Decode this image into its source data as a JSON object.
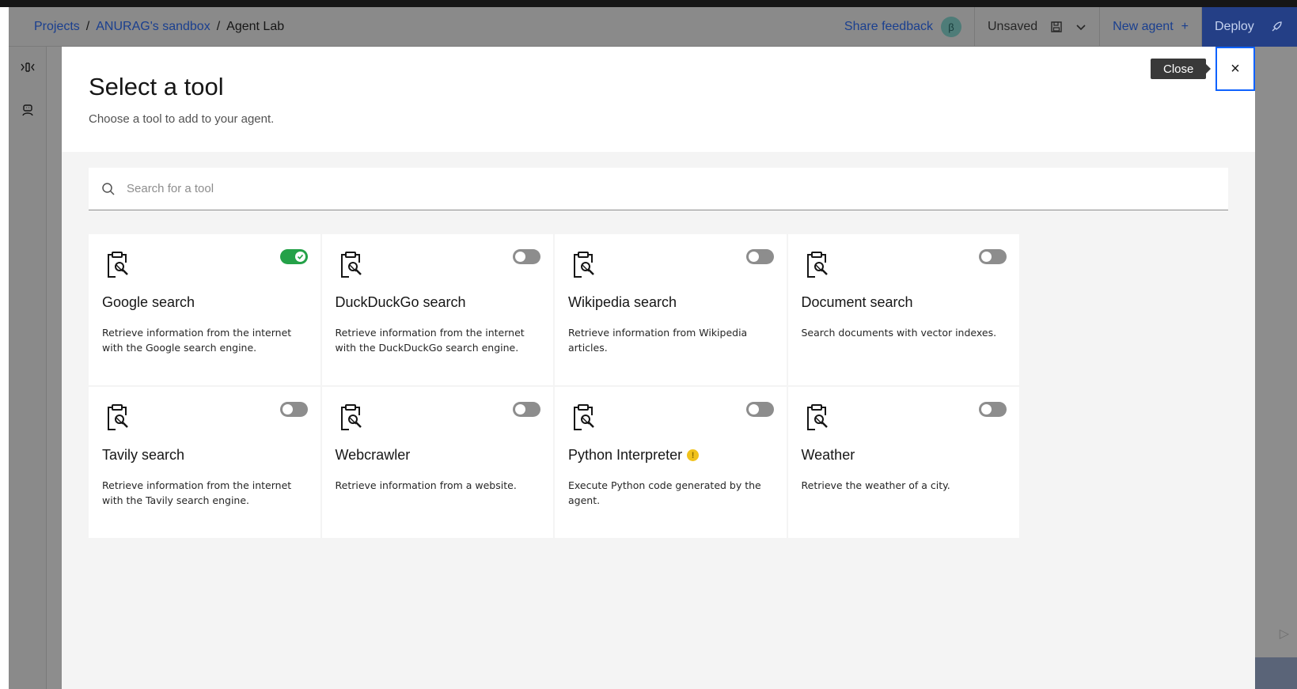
{
  "header": {
    "breadcrumb": [
      {
        "label": "Projects"
      },
      {
        "label": "ANURAG's sandbox"
      },
      {
        "label": "Agent Lab"
      }
    ],
    "share_feedback": "Share feedback",
    "beta_badge": "β",
    "status": "Unsaved",
    "new_agent": "New agent",
    "new_agent_plus": "+",
    "deploy": "Deploy"
  },
  "modal": {
    "title": "Select a tool",
    "subtitle": "Choose a tool to add to your agent.",
    "close_tooltip": "Close",
    "close_glyph": "×",
    "search_placeholder": "Search for a tool",
    "tools": [
      {
        "name": "Google search",
        "description": "Retrieve information from the internet with the Google search engine.",
        "enabled": true
      },
      {
        "name": "DuckDuckGo search",
        "description": "Retrieve information from the internet with the DuckDuckGo search engine.",
        "enabled": false
      },
      {
        "name": "Wikipedia search",
        "description": "Retrieve information from Wikipedia articles.",
        "enabled": false
      },
      {
        "name": "Document search",
        "description": "Search documents with vector indexes.",
        "enabled": false
      },
      {
        "name": "Tavily search",
        "description": "Retrieve information from the internet with the Tavily search engine.",
        "enabled": false
      },
      {
        "name": "Webcrawler",
        "description": "Retrieve information from a website.",
        "enabled": false
      },
      {
        "name": "Python Interpreter",
        "description": "Execute Python code generated by the agent.",
        "enabled": false,
        "warning": true
      },
      {
        "name": "Weather",
        "description": "Retrieve the weather of a city.",
        "enabled": false
      }
    ]
  },
  "colors": {
    "toggle_on": "#24a148",
    "toggle_off": "#8d8d8d",
    "focus": "#0f62fe",
    "link": "#0f62fe",
    "warning": "#f1c21b"
  },
  "icons": {
    "tool": "clipboard-search-icon",
    "search": "search-icon",
    "close": "close-icon",
    "save": "save-icon",
    "dropdown": "chevron-down-icon",
    "deploy": "rocket-icon"
  }
}
